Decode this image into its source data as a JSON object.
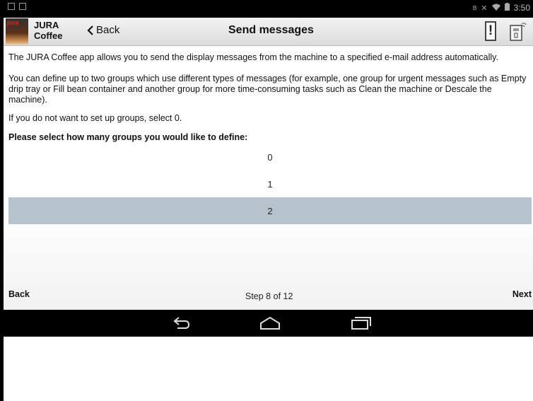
{
  "status_bar": {
    "time": "3:50"
  },
  "app": {
    "name_line1": "JURA",
    "name_line2": "Coffee",
    "logo_text": "jura"
  },
  "header": {
    "back_label": "Back",
    "title": "Send messages",
    "warning_glyph": "!"
  },
  "content": {
    "paragraph1": "The JURA Coffee app allows you to send the display messages from the machine to a specified e-mail address automatically.",
    "paragraph2": "You can define up to two groups which use different types of messages (for example, one group for urgent messages such as Empty drip tray or Fill bean container and another group for more time-consuming tasks such as Clean the machine or Descale the machine).",
    "paragraph3": "If you do not want to set up groups, select 0.",
    "prompt": "Please select how many groups you would like to define:",
    "options": [
      "0",
      "1",
      "2"
    ],
    "selected_option": "2"
  },
  "footer": {
    "back_label": "Back",
    "step_text": "Step 8 of 12",
    "next_label": "Next"
  },
  "colors": {
    "selected_row": "#b6c3cc",
    "status_bar": "#000000",
    "nav_bar": "#000000"
  },
  "icons": {
    "status_left": [
      "image-icon",
      "notification-icon"
    ],
    "status_right": [
      "bluetooth-icon",
      "mute-icon",
      "wifi-icon",
      "battery-icon"
    ],
    "navigation": [
      "back-nav-icon",
      "home-nav-icon",
      "recent-apps-icon"
    ]
  }
}
